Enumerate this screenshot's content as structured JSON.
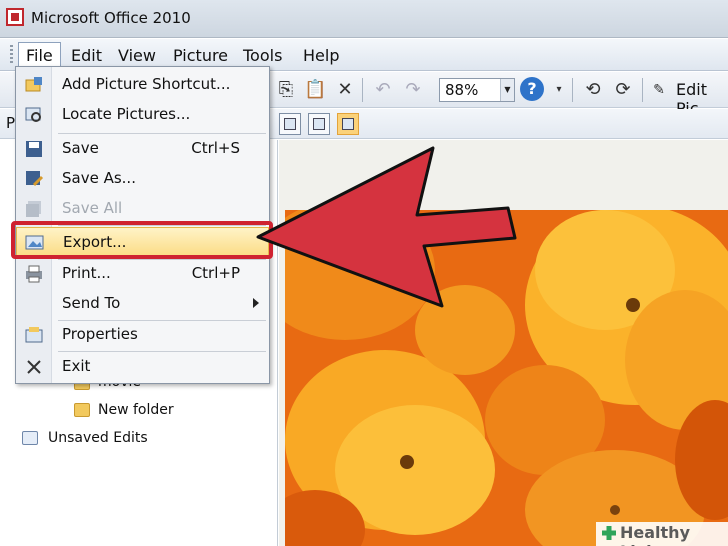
{
  "window": {
    "title": "Microsoft Office 2010"
  },
  "menubar": {
    "items": [
      "File",
      "Edit",
      "View",
      "Picture",
      "Tools",
      "Help"
    ]
  },
  "toolbar": {
    "zoom_value": "88%",
    "help_glyph": "?",
    "edit_pictures_label": "Edit Pic"
  },
  "toolbar2": {
    "letter": "P"
  },
  "file_menu": {
    "items": [
      {
        "label": "Add Picture Shortcut...",
        "shortcut": "",
        "icon": "add-shortcut-icon",
        "enabled": true
      },
      {
        "label": "Locate Pictures...",
        "shortcut": "",
        "icon": "locate-pictures-icon",
        "enabled": true
      },
      {
        "label": "Save",
        "shortcut": "Ctrl+S",
        "icon": "save-icon",
        "enabled": true
      },
      {
        "label": "Save As...",
        "shortcut": "",
        "icon": "save-as-icon",
        "enabled": true
      },
      {
        "label": "Save All",
        "shortcut": "",
        "icon": "save-all-icon",
        "enabled": false
      },
      {
        "label": "Export...",
        "shortcut": "",
        "icon": "export-icon",
        "enabled": true,
        "highlighted": true
      },
      {
        "label": "Print...",
        "shortcut": "Ctrl+P",
        "icon": "print-icon",
        "enabled": true
      },
      {
        "label": "Send To",
        "shortcut": "",
        "icon": "",
        "enabled": true,
        "submenu": true
      },
      {
        "label": "Properties",
        "shortcut": "",
        "icon": "properties-icon",
        "enabled": true
      },
      {
        "label": "Exit",
        "shortcut": "",
        "icon": "close-icon",
        "enabled": true
      }
    ]
  },
  "tree": {
    "items": [
      "movie",
      "New folder",
      "Unsaved Edits"
    ]
  },
  "watermark": {
    "text": "Healthy Living"
  },
  "colors": {
    "highlight_outline": "#cf2230",
    "arrow_fill": "#d5333f",
    "menu_highlight": "#fbdc85"
  }
}
